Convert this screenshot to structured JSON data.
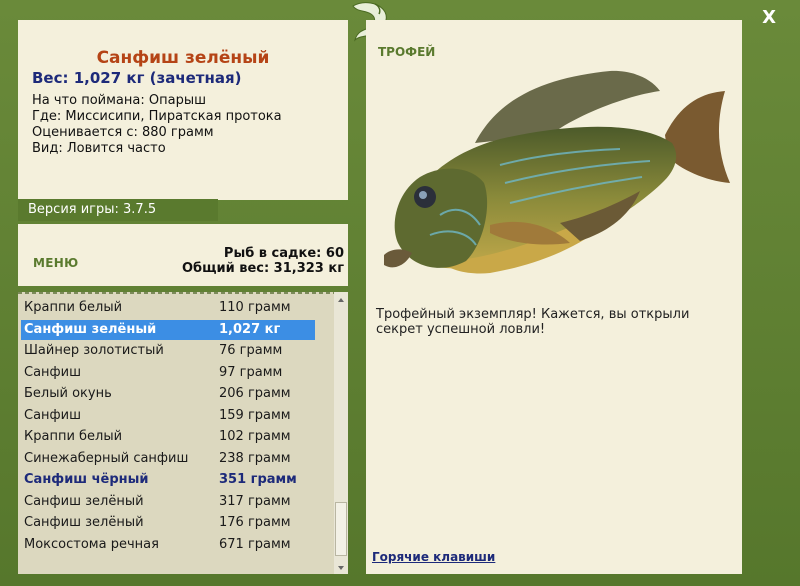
{
  "fish": {
    "name": "Санфиш зелёный",
    "weight_line": "Вес: 1,027 кг (зачетная)",
    "bait": "На что поймана: Опарыш",
    "place": "Где: Миссисипи, Пиратская протока",
    "value": "Оценивается с: 880 грамм",
    "kind": "Вид: Ловится часто"
  },
  "version": "Версия игры: 3.7.5",
  "menu_label": "МЕНЮ",
  "stats": {
    "count": "Рыб в садке: 60",
    "total": "Общий вес: 31,323 кг"
  },
  "catch_list": [
    {
      "name": "Краппи белый",
      "weight": "110 грамм",
      "state": "normal"
    },
    {
      "name": "Санфиш зелёный",
      "weight": "1,027 кг",
      "state": "selected"
    },
    {
      "name": "Шайнер золотистый",
      "weight": "76 грамм",
      "state": "normal"
    },
    {
      "name": "Санфиш",
      "weight": "97 грамм",
      "state": "normal"
    },
    {
      "name": "Белый окунь",
      "weight": "206 грамм",
      "state": "normal"
    },
    {
      "name": "Санфиш",
      "weight": "159 грамм",
      "state": "normal"
    },
    {
      "name": "Краппи белый",
      "weight": "102 грамм",
      "state": "normal"
    },
    {
      "name": "Синежаберный санфиш",
      "weight": "238 грамм",
      "state": "normal"
    },
    {
      "name": "Санфиш чёрный",
      "weight": "351 грамм",
      "state": "highlight"
    },
    {
      "name": "Санфиш зелёный",
      "weight": "317 грамм",
      "state": "normal"
    },
    {
      "name": "Санфиш зелёный",
      "weight": "176 грамм",
      "state": "normal"
    },
    {
      "name": "Моксостома речная",
      "weight": "671 грамм",
      "state": "normal"
    }
  ],
  "trophy_label": "ТРОФЕЙ",
  "trophy_text": "Трофейный экземпляр! Кажется, вы открыли секрет успешной ловли!",
  "hotkeys": "Горячие клавиши",
  "close": "X",
  "colors": {
    "accent": "#5a7a2e",
    "title": "#b54416",
    "selection": "#3c8ee4",
    "weight": "#1d2a7a"
  }
}
